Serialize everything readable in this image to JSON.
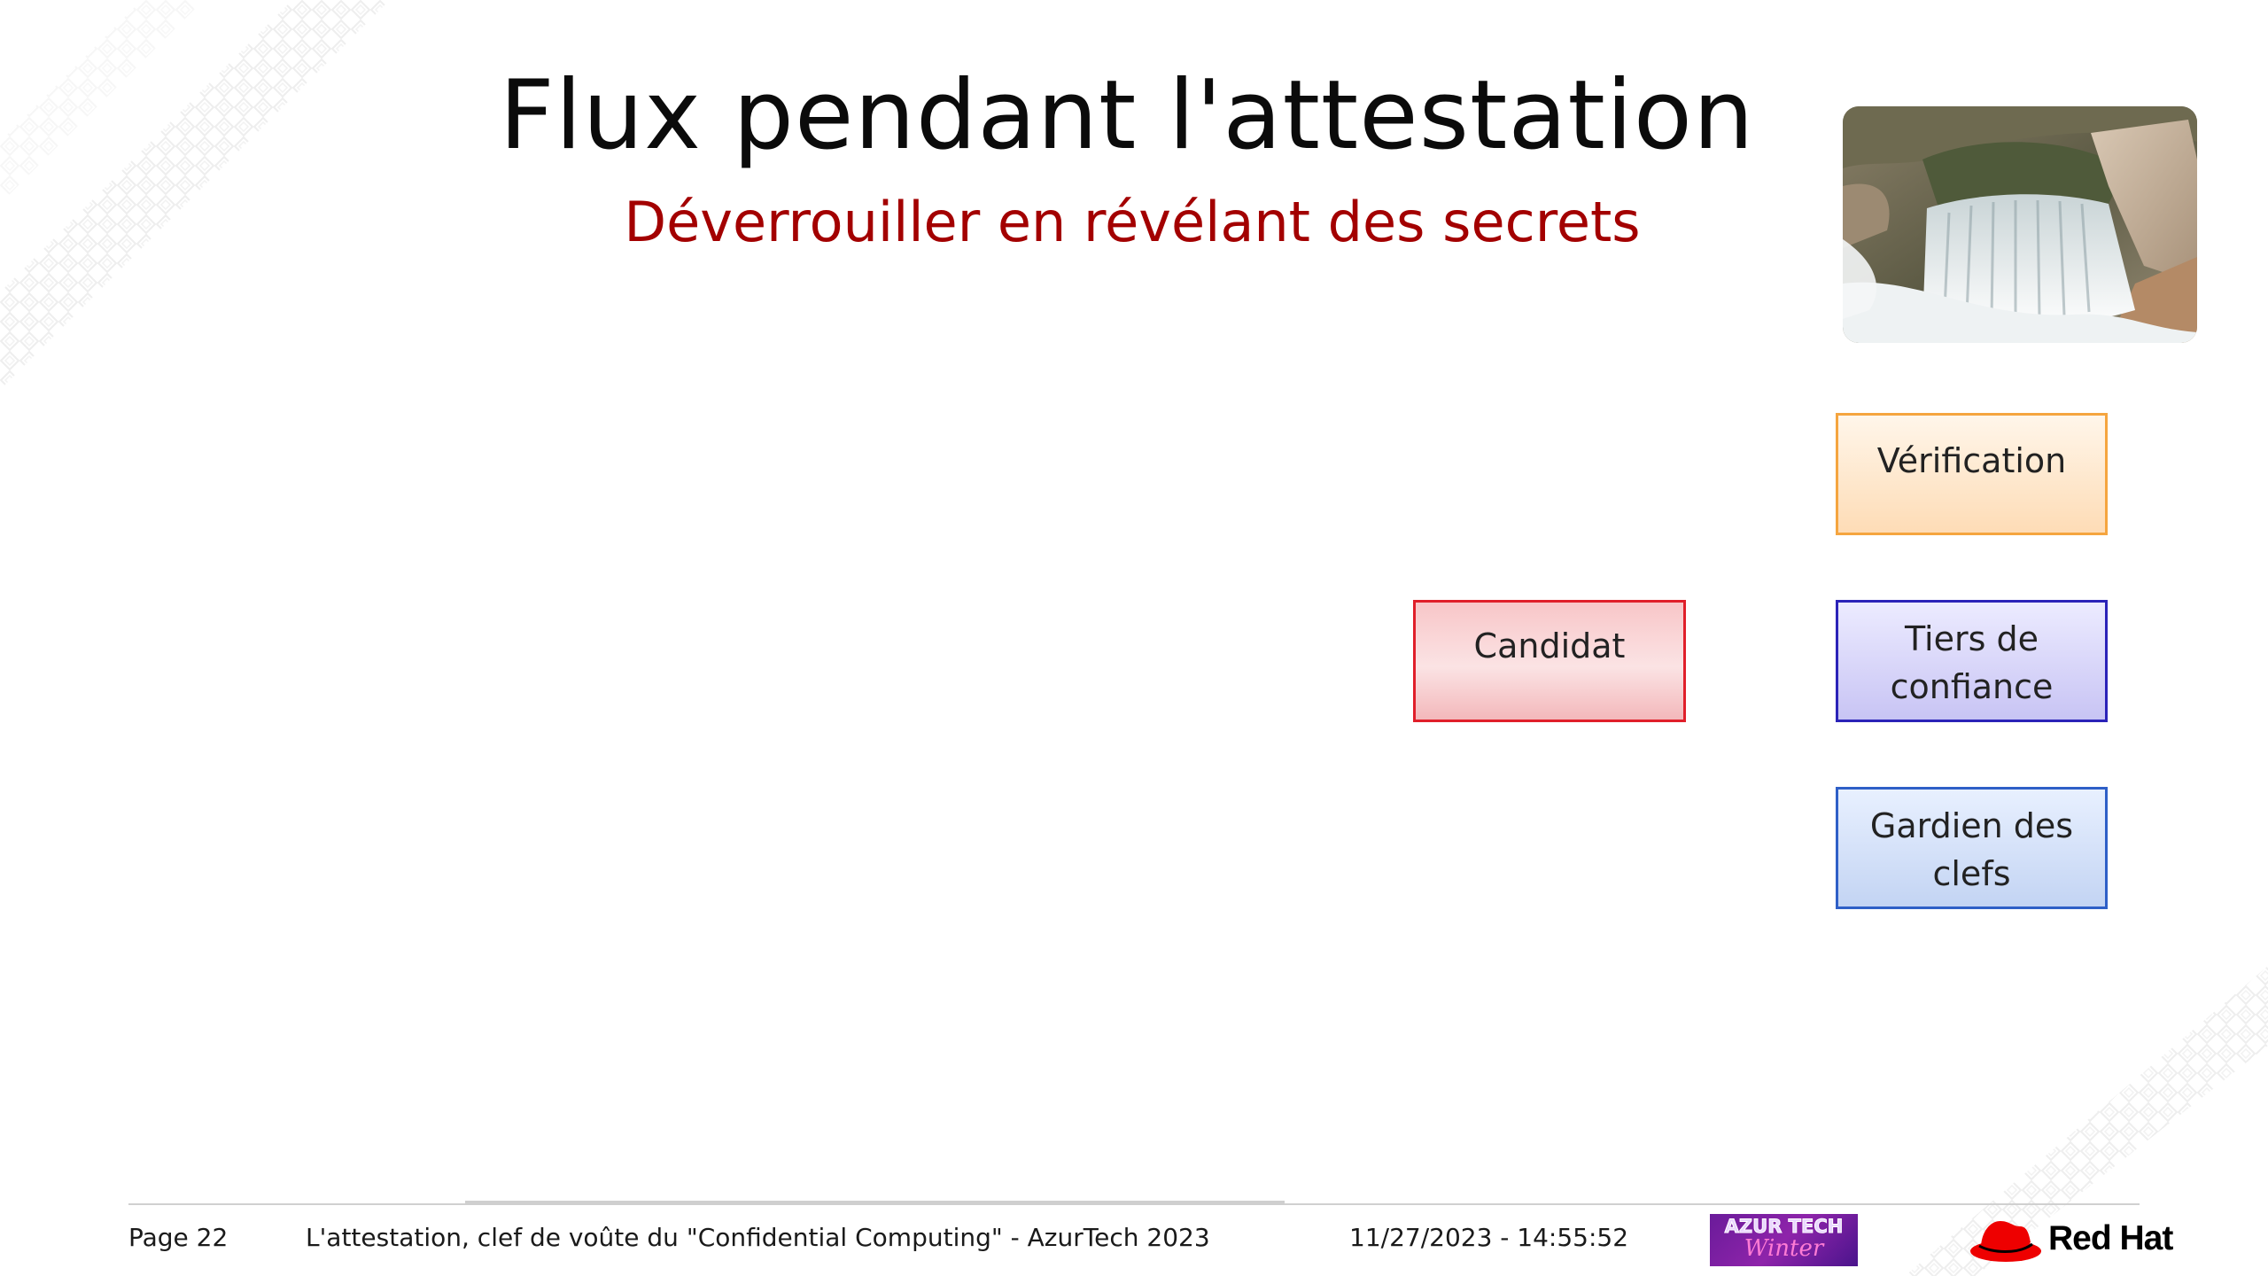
{
  "slide": {
    "title": "Flux pendant l'attestation",
    "subtitle": "Déverrouiller en révélant des secrets"
  },
  "roles": {
    "verification": "Vérification",
    "candidat": "Candidat",
    "tiers_line1": "Tiers de",
    "tiers_line2": "confiance",
    "gardien_line1": "Gardien des",
    "gardien_line2": "clefs"
  },
  "footer": {
    "page": "Page 22",
    "title": "L'attestation, clef de voûte du \"Confidential Computing\" - AzurTech 2023",
    "datetime": "11/27/2023 - 14:55:52",
    "azur_logo_top": "AZUR TECH",
    "azur_logo_bottom": "Winter",
    "redhat_logo": "Red Hat"
  },
  "colors": {
    "title": "#0b0b0b",
    "subtitle": "#a30000",
    "verification_border": "#f5a53f",
    "candidat_border": "#e01f2a",
    "tiers_border": "#2b23b8",
    "gardien_border": "#2e5fc7",
    "redhat_red": "#ee0000"
  },
  "images": {
    "photo": "waterfall-over-rocks"
  }
}
